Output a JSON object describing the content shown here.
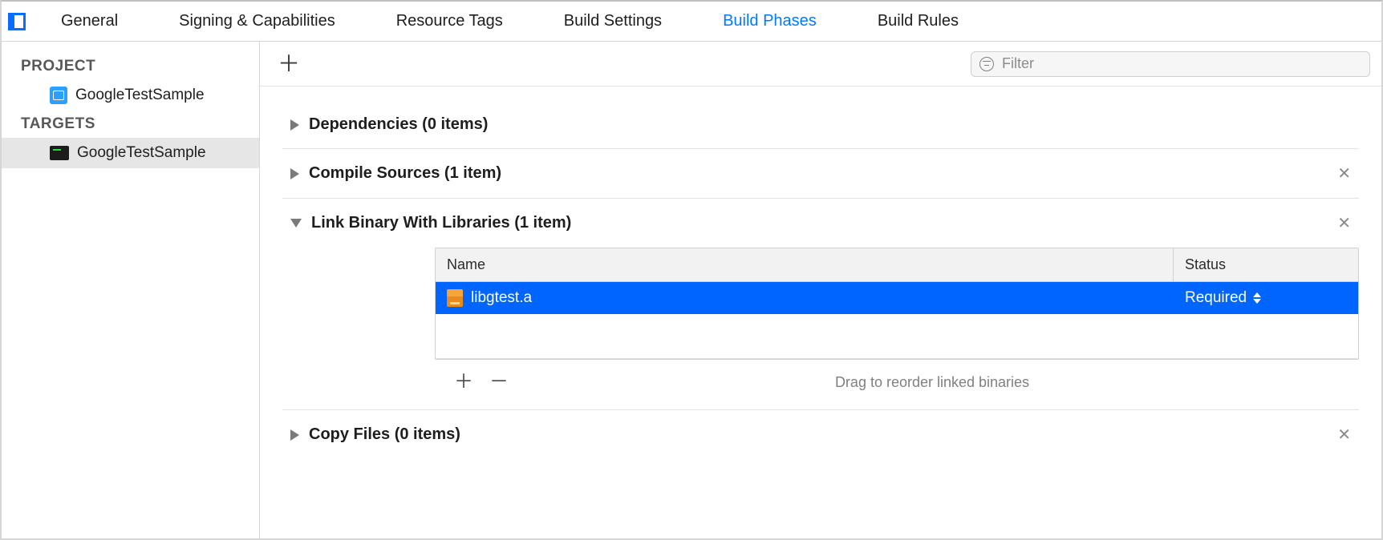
{
  "tabs": {
    "general": "General",
    "signing": "Signing & Capabilities",
    "resource_tags": "Resource Tags",
    "build_settings": "Build Settings",
    "build_phases": "Build Phases",
    "build_rules": "Build Rules"
  },
  "sidebar": {
    "project_label": "PROJECT",
    "project_name": "GoogleTestSample",
    "targets_label": "TARGETS",
    "target_name": "GoogleTestSample"
  },
  "toolbar": {
    "filter_placeholder": "Filter"
  },
  "phases": {
    "dependencies": {
      "title": "Dependencies (0 items)"
    },
    "compile_sources": {
      "title": "Compile Sources (1 item)"
    },
    "link_binary": {
      "title": "Link Binary With Libraries (1 item)",
      "col_name": "Name",
      "col_status": "Status",
      "row": {
        "name": "libgtest.a",
        "status": "Required"
      },
      "hint": "Drag to reorder linked binaries"
    },
    "copy_files": {
      "title": "Copy Files (0 items)"
    }
  },
  "glyphs": {
    "plus": "＋",
    "minus": "－",
    "close": "✕"
  }
}
